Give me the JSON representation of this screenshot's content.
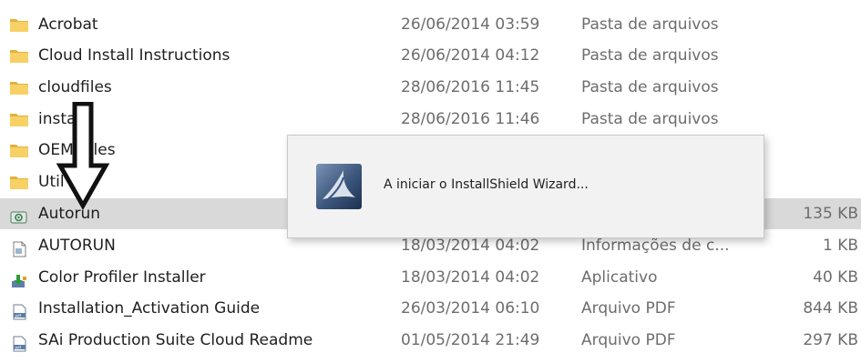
{
  "files": [
    {
      "name": "Acrobat",
      "date": "26/06/2014 03:59",
      "type": "Pasta de arquivos",
      "size": "",
      "icon": "folder-icon"
    },
    {
      "name": "Cloud Install Instructions",
      "date": "26/06/2014 04:12",
      "type": "Pasta de arquivos",
      "size": "",
      "icon": "folder-icon"
    },
    {
      "name": "cloudfiles",
      "date": "28/06/2016 11:45",
      "type": "Pasta de arquivos",
      "size": "",
      "icon": "folder-icon"
    },
    {
      "name": "install",
      "date": "28/06/2016 11:46",
      "type": "Pasta de arquivos",
      "size": "",
      "icon": "folder-icon"
    },
    {
      "name": "OEM_Files",
      "date": "",
      "type": "",
      "size": "",
      "icon": "folder-icon"
    },
    {
      "name": "Util",
      "date": "",
      "type": "",
      "size": "",
      "icon": "folder-icon"
    },
    {
      "name": "Autorun",
      "date": "",
      "type": "",
      "size": "135 KB",
      "icon": "autorun-app-icon"
    },
    {
      "name": "AUTORUN",
      "date": "18/03/2014 04:02",
      "type": "Informações de c...",
      "size": "1 KB",
      "icon": "setup-info-icon"
    },
    {
      "name": "Color Profiler Installer",
      "date": "18/03/2014 04:02",
      "type": "Aplicativo",
      "size": "40 KB",
      "icon": "installer-app-icon"
    },
    {
      "name": "Installation_Activation Guide",
      "date": "26/03/2014 06:10",
      "type": "Arquivo PDF",
      "size": "844 KB",
      "icon": "pdf-file-icon"
    },
    {
      "name": "SAi Production Suite Cloud Readme",
      "date": "01/05/2014 21:49",
      "type": "Arquivo PDF",
      "size": "297 KB",
      "icon": "pdf-file-icon"
    }
  ],
  "popup": {
    "message": "A iniciar o InstallShield Wizard...",
    "icon": "installshield-logo-icon"
  },
  "overlay": {
    "icon": "down-arrow-icon"
  },
  "colors": {
    "folder": "#f7d166",
    "folder_dark": "#e2b23c",
    "selected_row": "#d9d9d9",
    "secondary_text": "#6d6d6d"
  }
}
